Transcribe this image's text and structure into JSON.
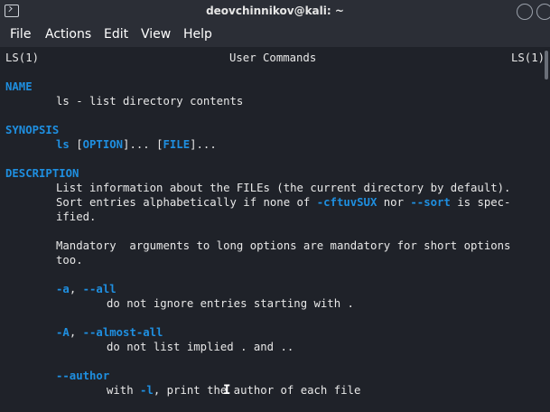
{
  "window": {
    "title": "deovchinnikov@kali: ~",
    "terminal_icon": "terminal-icon"
  },
  "menu": [
    "File",
    "Actions",
    "Edit",
    "View",
    "Help"
  ],
  "man": {
    "header_left": "LS(1)",
    "header_center": "User Commands",
    "header_right": "LS(1)",
    "name_heading": "NAME",
    "name_text": "ls - list directory contents",
    "synopsis_heading": "SYNOPSIS",
    "synopsis_cmd": "ls",
    "synopsis_open1": "[",
    "synopsis_option": "OPTION",
    "synopsis_close1": "]...",
    "synopsis_open2": "[",
    "synopsis_file": "FILE",
    "synopsis_close2": "]...",
    "description_heading": "DESCRIPTION",
    "desc_line1": "List information about the FILEs (the current directory by default).",
    "desc_line2_a": "Sort entries alphabetically if none of ",
    "desc_line2_opt1": "-cftuvSUX",
    "desc_line2_b": " nor ",
    "desc_line2_opt2": "--sort",
    "desc_line2_c": " is spec-",
    "desc_line3": "ified.",
    "mandatory_line1": "Mandatory  arguments to long options are mandatory for short options",
    "mandatory_line2": "too.",
    "opt_a_short": "-a",
    "opt_a_sep": ", ",
    "opt_a_long": "--all",
    "opt_a_desc": "do not ignore entries starting with .",
    "opt_A_short": "-A",
    "opt_A_sep": ", ",
    "opt_A_long": "--almost-all",
    "opt_A_desc": "do not list implied . and ..",
    "opt_author": "--author",
    "opt_author_desc_a": "with ",
    "opt_author_desc_opt": "-l",
    "opt_author_desc_b": ", print the author of each file"
  }
}
